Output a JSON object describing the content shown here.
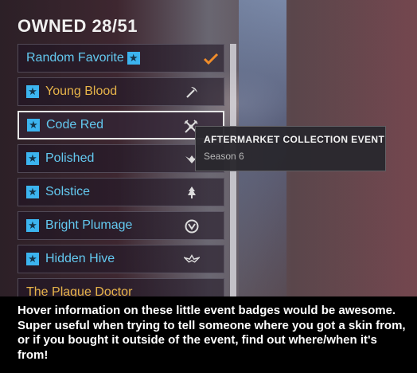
{
  "header": {
    "title": "OWNED 28/51"
  },
  "items": [
    {
      "label": "Random Favorite",
      "label_color": "blue",
      "favorite_icon": "star-badge-icon",
      "badge_icon": "checkmark-icon"
    },
    {
      "label": "Young Blood",
      "label_color": "gold",
      "favorite_icon": "star-badge-icon",
      "badge_icon": "pickaxe-icon"
    },
    {
      "label": "Code Red",
      "label_color": "blue",
      "favorite_icon": "star-badge-icon",
      "badge_icon": "crossed-tools-icon",
      "selected": true
    },
    {
      "label": "Polished",
      "label_color": "blue",
      "favorite_icon": "star-badge-icon",
      "badge_icon": "wings-icon"
    },
    {
      "label": "Solstice",
      "label_color": "blue",
      "favorite_icon": "star-badge-icon",
      "badge_icon": "tree-icon"
    },
    {
      "label": "Bright Plumage",
      "label_color": "blue",
      "favorite_icon": "star-badge-icon",
      "badge_icon": "emblem-icon"
    },
    {
      "label": "Hidden Hive",
      "label_color": "blue",
      "favorite_icon": "star-badge-icon",
      "badge_icon": "winged-emblem-icon"
    },
    {
      "label": "The Plague Doctor",
      "label_color": "gold"
    }
  ],
  "tooltip": {
    "title": "AFTERMARKET COLLECTION EVENT",
    "subtitle": "Season 6"
  },
  "caption": "Hover information on these little event badges would be awesome. Super useful when trying to tell someone where you got a skin from, or if you bought it outside of the event, find out where/when it's from!",
  "colors": {
    "label_blue": "#63c9f0",
    "label_gold": "#e7b44a",
    "favorite_badge": "#3cb4ef",
    "check": "#f08c2a"
  }
}
